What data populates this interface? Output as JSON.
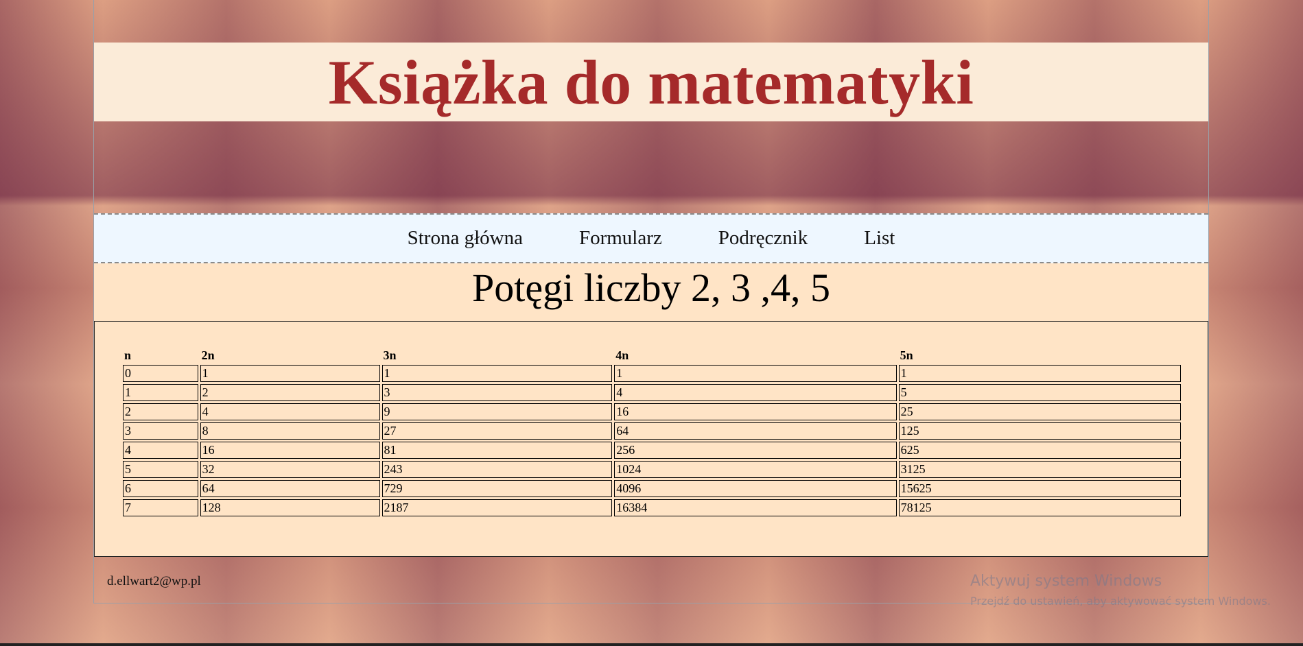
{
  "header": {
    "title": "Książka do matematyki"
  },
  "nav": {
    "items": [
      "Strona główna",
      "Formularz",
      "Podręcznik",
      "List"
    ]
  },
  "main": {
    "heading": "Potęgi liczby 2, 3 ,4, 5",
    "table": {
      "headers": [
        "n",
        "2n",
        "3n",
        "4n",
        "5n"
      ],
      "rows": [
        [
          "0",
          "1",
          "1",
          "1",
          "1"
        ],
        [
          "1",
          "2",
          "3",
          "4",
          "5"
        ],
        [
          "2",
          "4",
          "9",
          "16",
          "25"
        ],
        [
          "3",
          "8",
          "27",
          "64",
          "125"
        ],
        [
          "4",
          "16",
          "81",
          "256",
          "625"
        ],
        [
          "5",
          "32",
          "243",
          "1024",
          "3125"
        ],
        [
          "6",
          "64",
          "729",
          "4096",
          "15625"
        ],
        [
          "7",
          "128",
          "2187",
          "16384",
          "78125"
        ]
      ]
    }
  },
  "footer": {
    "email": "d.ellwart2@wp.pl"
  },
  "watermark": {
    "title": "Aktywuj system Windows",
    "subtitle": "Przejdź do ustawień, aby aktywować system Windows."
  }
}
